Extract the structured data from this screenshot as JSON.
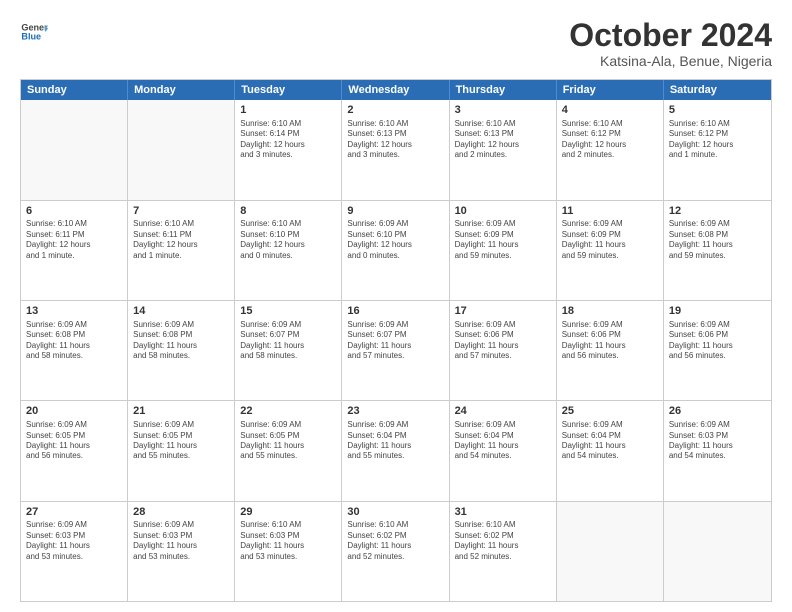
{
  "header": {
    "logo": {
      "line1": "General",
      "line2": "Blue"
    },
    "title": "October 2024",
    "location": "Katsina-Ala, Benue, Nigeria"
  },
  "weekdays": [
    "Sunday",
    "Monday",
    "Tuesday",
    "Wednesday",
    "Thursday",
    "Friday",
    "Saturday"
  ],
  "rows": [
    [
      {
        "day": "",
        "text": ""
      },
      {
        "day": "",
        "text": ""
      },
      {
        "day": "1",
        "text": "Sunrise: 6:10 AM\nSunset: 6:14 PM\nDaylight: 12 hours\nand 3 minutes."
      },
      {
        "day": "2",
        "text": "Sunrise: 6:10 AM\nSunset: 6:13 PM\nDaylight: 12 hours\nand 3 minutes."
      },
      {
        "day": "3",
        "text": "Sunrise: 6:10 AM\nSunset: 6:13 PM\nDaylight: 12 hours\nand 2 minutes."
      },
      {
        "day": "4",
        "text": "Sunrise: 6:10 AM\nSunset: 6:12 PM\nDaylight: 12 hours\nand 2 minutes."
      },
      {
        "day": "5",
        "text": "Sunrise: 6:10 AM\nSunset: 6:12 PM\nDaylight: 12 hours\nand 1 minute."
      }
    ],
    [
      {
        "day": "6",
        "text": "Sunrise: 6:10 AM\nSunset: 6:11 PM\nDaylight: 12 hours\nand 1 minute."
      },
      {
        "day": "7",
        "text": "Sunrise: 6:10 AM\nSunset: 6:11 PM\nDaylight: 12 hours\nand 1 minute."
      },
      {
        "day": "8",
        "text": "Sunrise: 6:10 AM\nSunset: 6:10 PM\nDaylight: 12 hours\nand 0 minutes."
      },
      {
        "day": "9",
        "text": "Sunrise: 6:09 AM\nSunset: 6:10 PM\nDaylight: 12 hours\nand 0 minutes."
      },
      {
        "day": "10",
        "text": "Sunrise: 6:09 AM\nSunset: 6:09 PM\nDaylight: 11 hours\nand 59 minutes."
      },
      {
        "day": "11",
        "text": "Sunrise: 6:09 AM\nSunset: 6:09 PM\nDaylight: 11 hours\nand 59 minutes."
      },
      {
        "day": "12",
        "text": "Sunrise: 6:09 AM\nSunset: 6:08 PM\nDaylight: 11 hours\nand 59 minutes."
      }
    ],
    [
      {
        "day": "13",
        "text": "Sunrise: 6:09 AM\nSunset: 6:08 PM\nDaylight: 11 hours\nand 58 minutes."
      },
      {
        "day": "14",
        "text": "Sunrise: 6:09 AM\nSunset: 6:08 PM\nDaylight: 11 hours\nand 58 minutes."
      },
      {
        "day": "15",
        "text": "Sunrise: 6:09 AM\nSunset: 6:07 PM\nDaylight: 11 hours\nand 58 minutes."
      },
      {
        "day": "16",
        "text": "Sunrise: 6:09 AM\nSunset: 6:07 PM\nDaylight: 11 hours\nand 57 minutes."
      },
      {
        "day": "17",
        "text": "Sunrise: 6:09 AM\nSunset: 6:06 PM\nDaylight: 11 hours\nand 57 minutes."
      },
      {
        "day": "18",
        "text": "Sunrise: 6:09 AM\nSunset: 6:06 PM\nDaylight: 11 hours\nand 56 minutes."
      },
      {
        "day": "19",
        "text": "Sunrise: 6:09 AM\nSunset: 6:06 PM\nDaylight: 11 hours\nand 56 minutes."
      }
    ],
    [
      {
        "day": "20",
        "text": "Sunrise: 6:09 AM\nSunset: 6:05 PM\nDaylight: 11 hours\nand 56 minutes."
      },
      {
        "day": "21",
        "text": "Sunrise: 6:09 AM\nSunset: 6:05 PM\nDaylight: 11 hours\nand 55 minutes."
      },
      {
        "day": "22",
        "text": "Sunrise: 6:09 AM\nSunset: 6:05 PM\nDaylight: 11 hours\nand 55 minutes."
      },
      {
        "day": "23",
        "text": "Sunrise: 6:09 AM\nSunset: 6:04 PM\nDaylight: 11 hours\nand 55 minutes."
      },
      {
        "day": "24",
        "text": "Sunrise: 6:09 AM\nSunset: 6:04 PM\nDaylight: 11 hours\nand 54 minutes."
      },
      {
        "day": "25",
        "text": "Sunrise: 6:09 AM\nSunset: 6:04 PM\nDaylight: 11 hours\nand 54 minutes."
      },
      {
        "day": "26",
        "text": "Sunrise: 6:09 AM\nSunset: 6:03 PM\nDaylight: 11 hours\nand 54 minutes."
      }
    ],
    [
      {
        "day": "27",
        "text": "Sunrise: 6:09 AM\nSunset: 6:03 PM\nDaylight: 11 hours\nand 53 minutes."
      },
      {
        "day": "28",
        "text": "Sunrise: 6:09 AM\nSunset: 6:03 PM\nDaylight: 11 hours\nand 53 minutes."
      },
      {
        "day": "29",
        "text": "Sunrise: 6:10 AM\nSunset: 6:03 PM\nDaylight: 11 hours\nand 53 minutes."
      },
      {
        "day": "30",
        "text": "Sunrise: 6:10 AM\nSunset: 6:02 PM\nDaylight: 11 hours\nand 52 minutes."
      },
      {
        "day": "31",
        "text": "Sunrise: 6:10 AM\nSunset: 6:02 PM\nDaylight: 11 hours\nand 52 minutes."
      },
      {
        "day": "",
        "text": ""
      },
      {
        "day": "",
        "text": ""
      }
    ]
  ]
}
